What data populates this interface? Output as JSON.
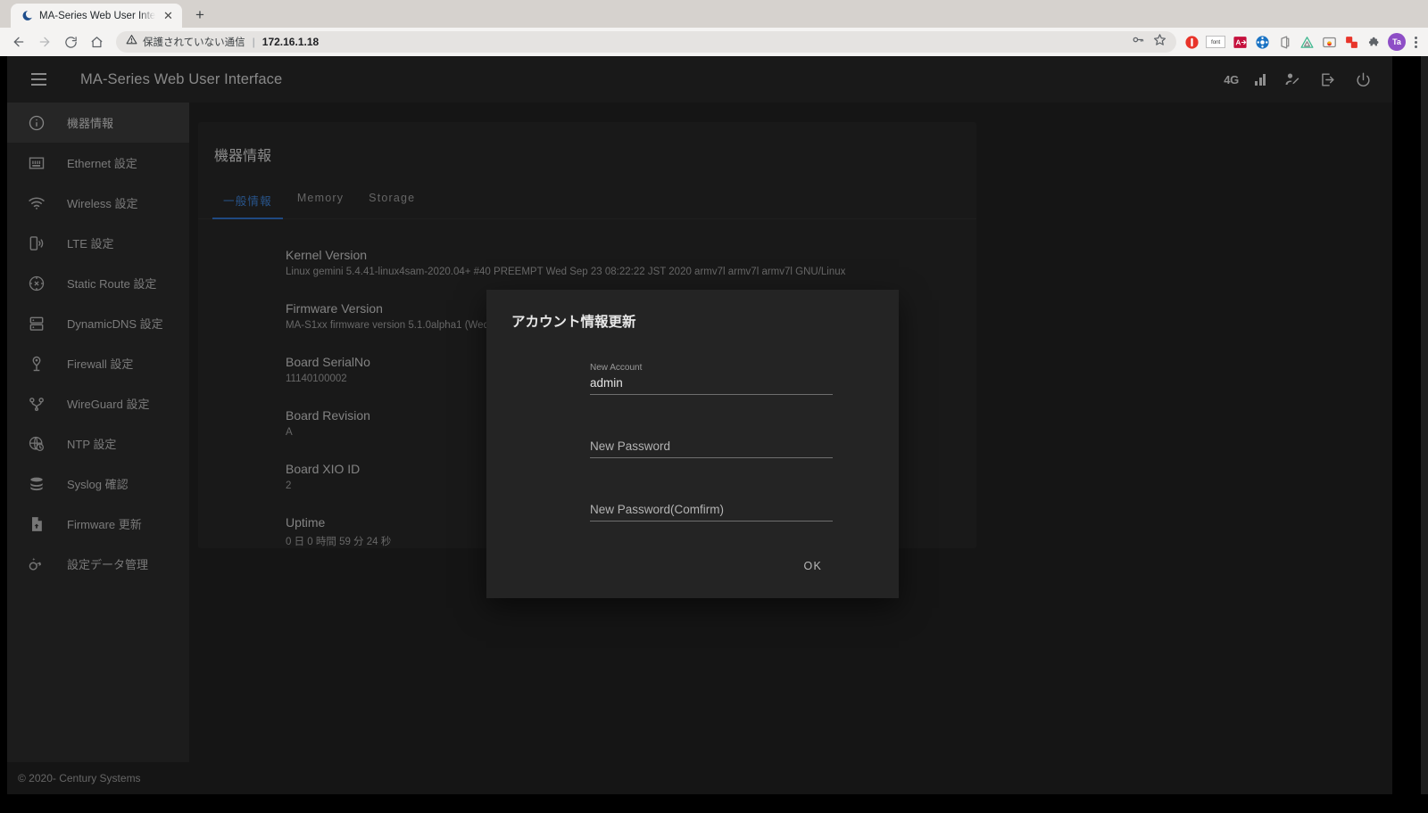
{
  "browser": {
    "tab": {
      "title": "MA-Series Web User Inter",
      "favicon_icon": "moon-favicon",
      "close_icon": "close-icon"
    },
    "new_tab_label": "+",
    "nav": {
      "back_icon": "back-arrow-icon",
      "forward_icon": "forward-arrow-icon",
      "reload_icon": "reload-icon",
      "home_icon": "home-icon"
    },
    "omnibox": {
      "security_icon": "warning-triangle-icon",
      "security_label": "保護されていない通信",
      "separator": "|",
      "url": "172.16.1.18",
      "key_icon": "key-icon",
      "star_icon": "star-icon"
    },
    "extensions": [
      {
        "name": "adblock-icon",
        "label": ""
      },
      {
        "name": "font-extension-icon",
        "label": "font"
      },
      {
        "name": "translate-extension-icon",
        "label": "A"
      },
      {
        "name": "bluetooth-extension-icon",
        "label": ""
      },
      {
        "name": "office-extension-icon",
        "label": ""
      },
      {
        "name": "triangle-extension-icon",
        "label": ""
      },
      {
        "name": "screenshot-extension-icon",
        "label": ""
      },
      {
        "name": "clipboard-extension-icon",
        "label": ""
      },
      {
        "name": "puzzle-extensions-icon",
        "label": ""
      }
    ],
    "profile_avatar": "Ta",
    "menu_icon": "three-dots-menu-icon"
  },
  "appbar": {
    "menu_icon": "hamburger-menu-icon",
    "title": "MA-Series Web User Interface",
    "network_label": "4G",
    "signal_icon": "signal-bars-icon",
    "account_icon": "user-edit-icon",
    "logout_icon": "logout-icon",
    "power_icon": "power-icon"
  },
  "sidebar": {
    "items": [
      {
        "label": "機器情報",
        "icon": "info-circle-icon",
        "active": true
      },
      {
        "label": "Ethernet 設定",
        "icon": "ethernet-port-icon",
        "active": false
      },
      {
        "label": "Wireless 設定",
        "icon": "wifi-icon",
        "active": false
      },
      {
        "label": "LTE 設定",
        "icon": "mobile-signal-icon",
        "active": false
      },
      {
        "label": "Static Route 設定",
        "icon": "route-compass-icon",
        "active": false
      },
      {
        "label": "DynamicDNS 設定",
        "icon": "server-rack-icon",
        "active": false
      },
      {
        "label": "Firewall 設定",
        "icon": "shield-pin-icon",
        "active": false
      },
      {
        "label": "WireGuard 設定",
        "icon": "wireguard-icon",
        "active": false
      },
      {
        "label": "NTP 設定",
        "icon": "globe-clock-icon",
        "active": false
      },
      {
        "label": "Syslog 確認",
        "icon": "database-stack-icon",
        "active": false
      },
      {
        "label": "Firmware 更新",
        "icon": "file-upload-icon",
        "active": false
      },
      {
        "label": "設定データ管理",
        "icon": "gears-icon",
        "active": false
      }
    ]
  },
  "footer": {
    "copyright": "© 2020- Century Systems"
  },
  "main": {
    "card_title": "機器情報",
    "tabs": [
      {
        "label": "一般情報",
        "active": true
      },
      {
        "label": "Memory",
        "active": false
      },
      {
        "label": "Storage",
        "active": false
      }
    ],
    "info": [
      {
        "label": "Kernel Version",
        "value": "Linux gemini 5.4.41-linux4sam-2020.04+ #40 PREEMPT Wed Sep 23 08:22:22 JST 2020 armv7l armv7l armv7l GNU/Linux"
      },
      {
        "label": "Firmware Version",
        "value": "MA-S1xx firmware version 5.1.0alpha1 (Wed"
      },
      {
        "label": "Board SerialNo",
        "value": "11140100002"
      },
      {
        "label": "Board Revision",
        "value": "A"
      },
      {
        "label": "Board XIO ID",
        "value": "2"
      },
      {
        "label": "Uptime",
        "value": "0 日 0 時間 59 分 24 秒"
      }
    ]
  },
  "modal": {
    "title": "アカウント情報更新",
    "fields": [
      {
        "float_label": "New Account",
        "value": "admin",
        "placeholder": "",
        "filled": true
      },
      {
        "float_label": "",
        "value": "",
        "placeholder": "New Password",
        "filled": false
      },
      {
        "float_label": "",
        "value": "",
        "placeholder": "New Password(Comfirm)",
        "filled": false
      }
    ],
    "ok_label": "OK"
  },
  "colors": {
    "accent_blue": "#3d7fd1",
    "app_bg": "#212121",
    "sidebar_bg": "#2b2b2b",
    "card_bg": "#262626",
    "modal_bg": "#242424"
  }
}
